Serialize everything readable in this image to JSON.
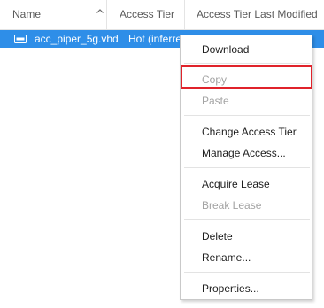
{
  "columns": {
    "name": "Name",
    "access_tier": "Access Tier",
    "access_tier_last_modified": "Access Tier Last Modified"
  },
  "row": {
    "name": "acc_piper_5g.vhd",
    "access_tier": "Hot (inferred)"
  },
  "context_menu": {
    "items": [
      {
        "label": "Download",
        "enabled": true
      },
      {
        "label": "Copy",
        "enabled": false,
        "highlighted": true
      },
      {
        "label": "Paste",
        "enabled": false
      },
      {
        "label": "Change Access Tier",
        "enabled": true
      },
      {
        "label": "Manage Access...",
        "enabled": true
      },
      {
        "label": "Acquire Lease",
        "enabled": true
      },
      {
        "label": "Break Lease",
        "enabled": false
      },
      {
        "label": "Delete",
        "enabled": true
      },
      {
        "label": "Rename...",
        "enabled": true
      },
      {
        "label": "Properties...",
        "enabled": true
      }
    ]
  },
  "icons": {
    "sort": "chevron-up-icon",
    "file": "disk-file-icon"
  },
  "colors": {
    "selection": "#2e8ee8",
    "highlight_border": "#e0232b",
    "disabled_text": "#a3a3a3"
  }
}
